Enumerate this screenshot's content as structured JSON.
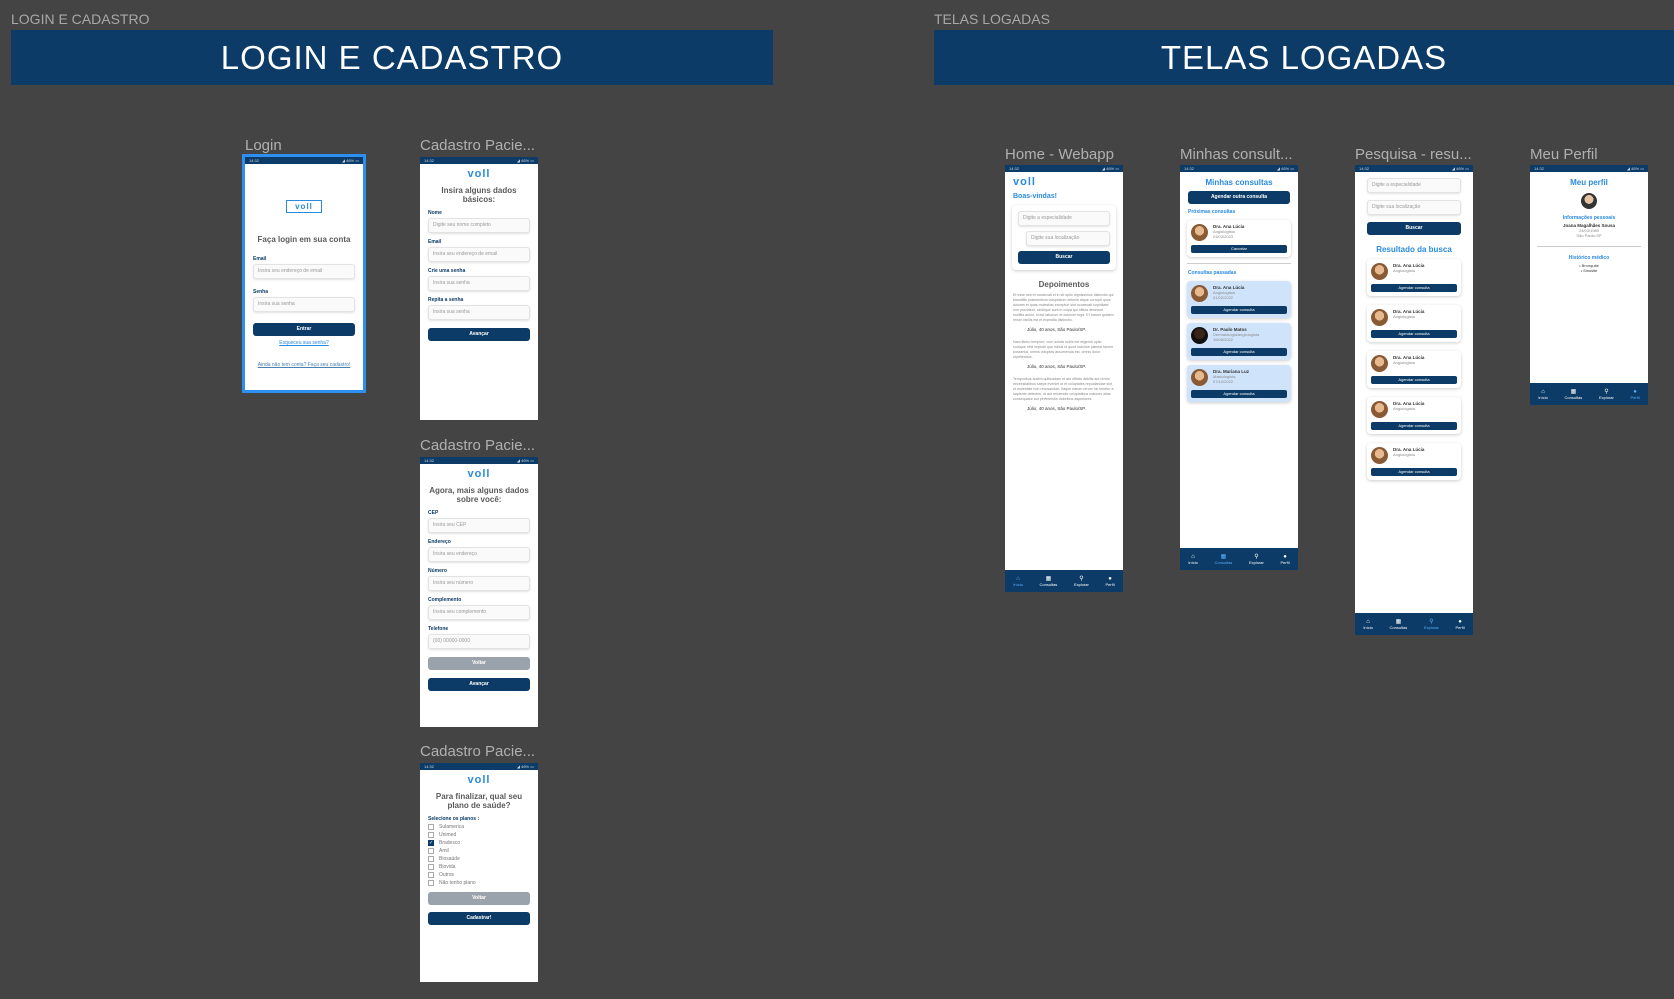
{
  "sections": {
    "left_label": "LOGIN E CADASTRO",
    "left_title": "LOGIN E CADASTRO",
    "right_label": "TELAS LOGADAS",
    "right_title": "TELAS LOGADAS"
  },
  "status_bar": {
    "time": "14:32",
    "right": "◢ 46% ▭"
  },
  "logo": "voll",
  "login": {
    "frame_title": "Login",
    "heading": "Faça login em sua conta",
    "email_label": "Email",
    "email_placeholder": "Insira seu endereço de email",
    "password_label": "Senha",
    "password_placeholder": "Insira sua senha",
    "submit": "Entrar",
    "forgot": "Esqueceu sua senha?",
    "signup": "Ainda não tem conta? Faça seu cadastro!"
  },
  "signup1": {
    "frame_title": "Cadastro Pacie...",
    "heading": "Insira alguns dados básicos:",
    "fields": [
      {
        "label": "Nome",
        "placeholder": "Digite seu nome completo"
      },
      {
        "label": "Email",
        "placeholder": "Insira seu endereço de email"
      },
      {
        "label": "Crie uma senha",
        "placeholder": "Insira sua senha"
      },
      {
        "label": "Repita a senha",
        "placeholder": "Insira sua senha"
      }
    ],
    "next": "Avançar"
  },
  "signup2": {
    "frame_title": "Cadastro Pacie...",
    "heading": "Agora, mais alguns dados sobre você:",
    "fields": [
      {
        "label": "CEP",
        "placeholder": "Insira seu CEP"
      },
      {
        "label": "Endereço",
        "placeholder": "Insira seu endereço"
      },
      {
        "label": "Número",
        "placeholder": "Insira seu número"
      },
      {
        "label": "Complemento",
        "placeholder": "Insira seu complemento"
      },
      {
        "label": "Telefone",
        "placeholder": "(00) 00000-0000"
      }
    ],
    "back": "Voltar",
    "next": "Avançar"
  },
  "signup3": {
    "frame_title": "Cadastro Pacie...",
    "heading": "Para finalizar, qual seu plano de saúde?",
    "select_label": "Selecione os planos :",
    "plans": [
      {
        "name": "Sulamerica",
        "checked": false
      },
      {
        "name": "Unimed",
        "checked": false
      },
      {
        "name": "Bradesco",
        "checked": true
      },
      {
        "name": "Amil",
        "checked": false
      },
      {
        "name": "Biosaúde",
        "checked": false
      },
      {
        "name": "Biovida",
        "checked": false
      },
      {
        "name": "Outros",
        "checked": false
      },
      {
        "name": "Não tenho plano",
        "checked": false
      }
    ],
    "back": "Voltar",
    "submit": "Cadastrar!"
  },
  "tabs": [
    "Início",
    "Consultas",
    "Explorar",
    "Perfil"
  ],
  "home": {
    "frame_title": "Home - Webapp",
    "welcome": "Boas-vindas!",
    "specialty_placeholder": "Digite a especialidade",
    "location_placeholder": "Digite sua localização",
    "search": "Buscar",
    "testimonials_title": "Depoimentos",
    "testimonials": [
      {
        "text": "Et esse sint et occaecati et in sit optio dignissimos distinctio qui blanditiis praesentium voluptatum deleniti atque corrupti quos dolores et quas molestias excepturi sint occaecati cupiditate non provident, similique sunt in culpa qui officia deserunt mollitia animi, id est laborum et dolorum fuga. Et harum quidem rerum facilis est et expedita distinctio.",
        "author": "Júlio, 40 anos, São Paulo/SP."
      },
      {
        "text": "Nam libero tempore, cum soluta nobis est eligendi optio cumque nihil impedit quo minus id quod maxime placeat facere possimus, omnis voluptas assumenda est, omnis dolor repellendus.",
        "author": "Júlio, 40 anos, São Paulo/SP."
      },
      {
        "text": "Temporibus autem quibusdam et aut officiis debitis aut rerum necessitatibus saepe eveniet ut et voluptates repudiandae sint et molestiae non recusandae. Itaque earum rerum hic tenetur a sapiente delectus, ut aut reiciendis voluptatibus maiores alias consequatur aut perferendis doloribus asperiores.",
        "author": "Júlio, 40 anos, São Paulo/SP."
      }
    ]
  },
  "consultas": {
    "frame_title": "Minhas consult...",
    "title": "Minhas consultas",
    "new": "Agendar outra consulta",
    "upcoming_label": "Próximas consultas",
    "upcoming": {
      "name": "Dra. Ana Lúcia",
      "spec": "Angiologista",
      "date": "03/03/2023",
      "action": "Cancelar"
    },
    "past_label": "Consultas passadas",
    "past": [
      {
        "name": "Dra. Ana Lúcia",
        "spec": "Angiologista",
        "date": "01/02/2022",
        "action": "Agendar consulta"
      },
      {
        "name": "Dr. Paulo Matos",
        "spec": "Dermatologia/angiologista",
        "date": "16/08/2022",
        "action": "Agendar consulta"
      },
      {
        "name": "Dra. Mariana Luz",
        "spec": "Mastologista",
        "date": "07/10/2022",
        "action": "Agendar consulta"
      }
    ]
  },
  "pesquisa": {
    "frame_title": "Pesquisa - resu...",
    "specialty_placeholder": "Digite a especialidade",
    "location_placeholder": "Digite sua localização",
    "search": "Buscar",
    "results_title": "Resultado da busca",
    "results": [
      {
        "name": "Dra. Ana Lúcia",
        "spec": "Angiologista",
        "action": "Agendar consulta"
      },
      {
        "name": "Dra. Ana Lúcia",
        "spec": "Angiologista",
        "action": "Agendar consulta"
      },
      {
        "name": "Dra. Ana Lúcia",
        "spec": "Angiologista",
        "action": "Agendar consulta"
      },
      {
        "name": "Dra. Ana Lúcia",
        "spec": "Angiologista",
        "action": "Agendar consulta"
      },
      {
        "name": "Dra. Ana Lúcia",
        "spec": "Angiologista",
        "action": "Agendar consulta"
      }
    ]
  },
  "perfil": {
    "frame_title": "Meu Perfil",
    "title": "Meu perfil",
    "personal_label": "Informações pessoais",
    "name": "Joana Magalhães Sousa",
    "birth": "24/03/1980",
    "city": "São Paulo-SP",
    "history_label": "Histórico médico",
    "history": [
      "• Bronquite",
      "• Sinusite"
    ]
  }
}
